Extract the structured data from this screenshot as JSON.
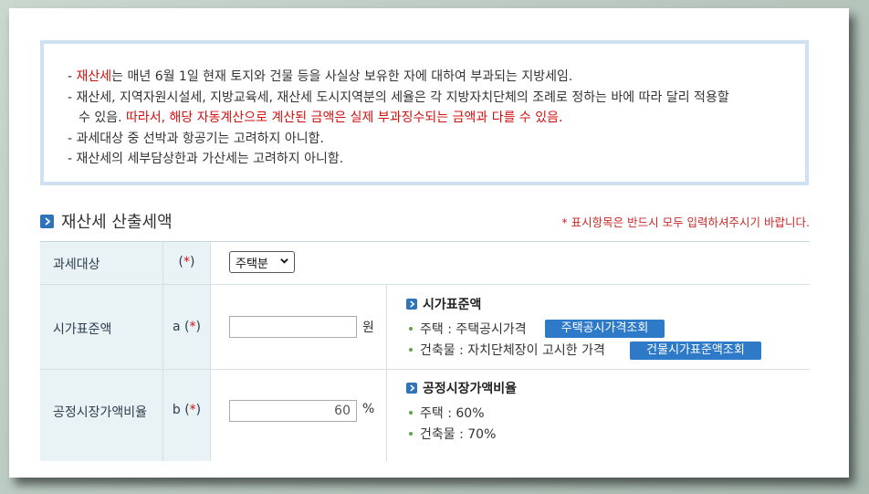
{
  "notice": {
    "line1": {
      "prefix": "- ",
      "highlight": "재산세",
      "rest": "는 매년 6월 1일 현재 토지와 건물 등을 사실상 보유한 자에 대하여 부과되는 지방세임."
    },
    "line2": "- 재산세, 지역자원시설세, 지방교육세, 재산세 도시지역분의 세율은 각 지방자치단체의 조례로 정하는 바에 따라 달리 적용할",
    "line3": {
      "prefix": "수 있음. ",
      "highlight": "따라서, 해당 자동계산으로 계산된 금액은 실제 부과징수되는 금액과 다를 수 있음."
    },
    "line4": "- 과세대상 중 선박과 항공기는 고려하지 아니함.",
    "line5": "- 재산세의 세부담상한과 가산세는 고려하지 아니함."
  },
  "section": {
    "title": "재산세 산출세액",
    "required_note": "* 표시항목은 반드시 모두 입력하셔주시기 바랍니다."
  },
  "rows": {
    "tax_object": {
      "label": "과세대상",
      "mark_prefix": "(",
      "mark_star": "*",
      "mark_suffix": ")",
      "selected": "주택분"
    },
    "standard_price": {
      "label": "시가표준액",
      "mark_prefix": "a (",
      "mark_star": "*",
      "mark_suffix": ")",
      "value": "",
      "unit": "원",
      "info_title": "시가표준액",
      "item1": "주택 : 주택공시가격",
      "button1": "주택공시가격조회",
      "item2": "건축물 : 자치단체장이 고시한 가격",
      "button2": "건물시가표준액조회"
    },
    "market_ratio": {
      "label": "공정시장가액비율",
      "mark_prefix": "b (",
      "mark_star": "*",
      "mark_suffix": ")",
      "value": "60",
      "unit": "%",
      "info_title": "공정시장가액비율",
      "item1": "주택 : 60%",
      "item2": "건축물 : 70%"
    }
  },
  "colors": {
    "accent": "#2e7ac9",
    "required": "#d11010",
    "label_bg": "#e9f2f4"
  }
}
